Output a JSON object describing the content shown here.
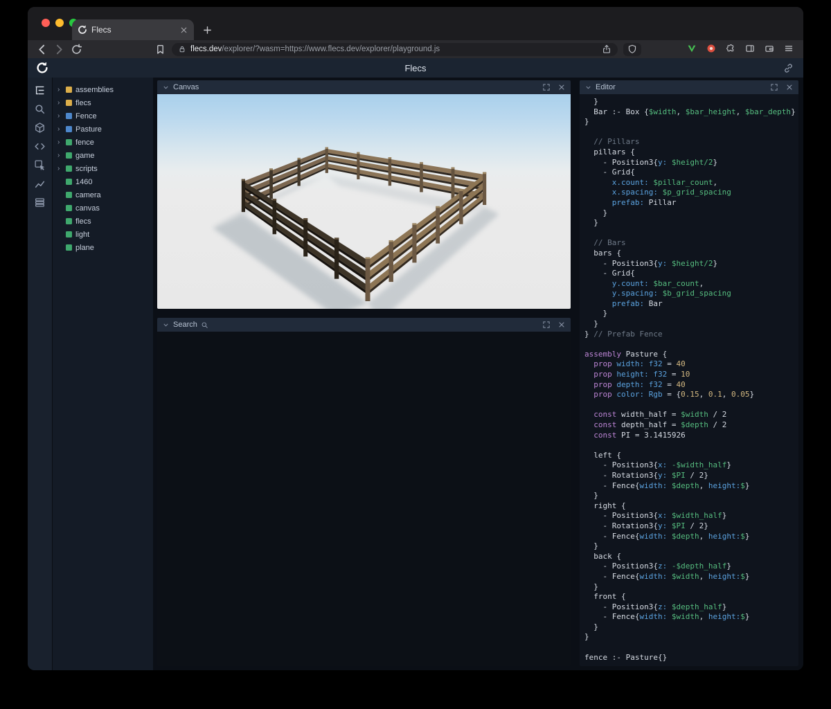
{
  "browser": {
    "tab_title": "Flecs",
    "url": {
      "domain": "flecs.dev",
      "rest": "/explorer/?wasm=https://www.flecs.dev/explorer/playground.js"
    },
    "toolbar_icons": [
      "back-icon",
      "forward-icon",
      "reload-icon",
      "bookmark-icon",
      "lock-icon",
      "share-icon",
      "brave-shield-icon",
      "vimium-extension-icon",
      "red-extension-icon",
      "extensions-puzzle-icon",
      "sidebar-panel-icon",
      "wallet-icon",
      "menu-icon"
    ]
  },
  "app": {
    "title": "Flecs",
    "logo_icon": "flecs-logo-icon",
    "header_link_icon": "link-icon"
  },
  "sidebar": {
    "icons": [
      {
        "name": "entity-tree-icon",
        "icon": "tree",
        "active": true
      },
      {
        "name": "search-icon",
        "icon": "searchI",
        "active": false
      },
      {
        "name": "scene-cube-icon",
        "icon": "cube",
        "active": false
      },
      {
        "name": "script-code-icon",
        "icon": "code",
        "active": false
      },
      {
        "name": "inspect-cursor-icon",
        "icon": "inspect",
        "active": false
      },
      {
        "name": "stats-chart-icon",
        "icon": "chart",
        "active": false
      },
      {
        "name": "memory-rows-icon",
        "icon": "memory",
        "active": false
      }
    ]
  },
  "tree": {
    "items": [
      {
        "label": "assemblies",
        "color": "#dcae4a",
        "expandable": true
      },
      {
        "label": "flecs",
        "color": "#dcae4a",
        "expandable": true
      },
      {
        "label": "Fence",
        "color": "#4d87cb",
        "expandable": true
      },
      {
        "label": "Pasture",
        "color": "#4d87cb",
        "expandable": true
      },
      {
        "label": "fence",
        "color": "#3fa86d",
        "expandable": true
      },
      {
        "label": "game",
        "color": "#3fa86d",
        "expandable": true
      },
      {
        "label": "scripts",
        "color": "#3fa86d",
        "expandable": true
      },
      {
        "label": "1460",
        "color": "#3fa86d",
        "expandable": false
      },
      {
        "label": "camera",
        "color": "#3fa86d",
        "expandable": false
      },
      {
        "label": "canvas",
        "color": "#3fa86d",
        "expandable": false
      },
      {
        "label": "flecs",
        "color": "#3fa86d",
        "expandable": false
      },
      {
        "label": "light",
        "color": "#3fa86d",
        "expandable": false
      },
      {
        "label": "plane",
        "color": "#3fa86d",
        "expandable": false
      }
    ]
  },
  "panels": {
    "canvas": {
      "title": "Canvas"
    },
    "search": {
      "title": "Search"
    },
    "editor": {
      "title": "Editor"
    }
  },
  "scene": {
    "description": "3D render of a square wooden fence enclosure (Pasture assembly) on light gray ground under a pale blue sky",
    "sky_color": "#a9d0ec",
    "ground_color": "#e8e8e8",
    "fence_wood_light": "#8d7554",
    "fence_wood_dark": "#2c251d",
    "shadow_color": "#9aa6ae"
  },
  "editor_code": {
    "lines": [
      [
        [
          "d",
          "  }"
        ]
      ],
      [
        [
          "d",
          "  Bar :- Box {"
        ],
        [
          "v",
          "$width"
        ],
        [
          "d",
          ", "
        ],
        [
          "v",
          "$bar_height"
        ],
        [
          "d",
          ", "
        ],
        [
          "v",
          "$bar_depth"
        ],
        [
          "d",
          "}"
        ]
      ],
      [
        [
          "d",
          "}"
        ]
      ],
      [],
      [
        [
          "c",
          "  // Pillars"
        ]
      ],
      [
        [
          "d",
          "  pillars {"
        ]
      ],
      [
        [
          "d",
          "    - Position3{"
        ],
        [
          "p",
          "y:"
        ],
        [
          "d",
          " "
        ],
        [
          "v",
          "$height/2"
        ],
        [
          "d",
          "}"
        ]
      ],
      [
        [
          "d",
          "    - Grid{"
        ]
      ],
      [
        [
          "p",
          "      x.count:"
        ],
        [
          "d",
          " "
        ],
        [
          "v",
          "$pillar_count"
        ],
        [
          "d",
          ","
        ]
      ],
      [
        [
          "p",
          "      x.spacing:"
        ],
        [
          "d",
          " "
        ],
        [
          "v",
          "$p_grid_spacing"
        ]
      ],
      [
        [
          "p",
          "      prefab:"
        ],
        [
          "d",
          " Pillar"
        ]
      ],
      [
        [
          "d",
          "    }"
        ]
      ],
      [
        [
          "d",
          "  }"
        ]
      ],
      [],
      [
        [
          "c",
          "  // Bars"
        ]
      ],
      [
        [
          "d",
          "  bars {"
        ]
      ],
      [
        [
          "d",
          "    - Position3{"
        ],
        [
          "p",
          "y:"
        ],
        [
          "d",
          " "
        ],
        [
          "v",
          "$height/2"
        ],
        [
          "d",
          "}"
        ]
      ],
      [
        [
          "d",
          "    - Grid{"
        ]
      ],
      [
        [
          "p",
          "      y.count:"
        ],
        [
          "d",
          " "
        ],
        [
          "v",
          "$bar_count"
        ],
        [
          "d",
          ","
        ]
      ],
      [
        [
          "p",
          "      y.spacing:"
        ],
        [
          "d",
          " "
        ],
        [
          "v",
          "$b_grid_spacing"
        ]
      ],
      [
        [
          "p",
          "      prefab:"
        ],
        [
          "d",
          " Bar"
        ]
      ],
      [
        [
          "d",
          "    }"
        ]
      ],
      [
        [
          "d",
          "  }"
        ]
      ],
      [
        [
          "d",
          "} "
        ],
        [
          "c",
          "// Prefab Fence"
        ]
      ],
      [],
      [
        [
          "k",
          "assembly"
        ],
        [
          "d",
          " Pasture {"
        ]
      ],
      [
        [
          "d",
          "  "
        ],
        [
          "k",
          "prop"
        ],
        [
          "d",
          " "
        ],
        [
          "p",
          "width:"
        ],
        [
          "d",
          " "
        ],
        [
          "t",
          "f32"
        ],
        [
          "d",
          " = "
        ],
        [
          "n",
          "40"
        ]
      ],
      [
        [
          "d",
          "  "
        ],
        [
          "k",
          "prop"
        ],
        [
          "d",
          " "
        ],
        [
          "p",
          "height:"
        ],
        [
          "d",
          " "
        ],
        [
          "t",
          "f32"
        ],
        [
          "d",
          " = "
        ],
        [
          "n",
          "10"
        ]
      ],
      [
        [
          "d",
          "  "
        ],
        [
          "k",
          "prop"
        ],
        [
          "d",
          " "
        ],
        [
          "p",
          "depth:"
        ],
        [
          "d",
          " "
        ],
        [
          "t",
          "f32"
        ],
        [
          "d",
          " = "
        ],
        [
          "n",
          "40"
        ]
      ],
      [
        [
          "d",
          "  "
        ],
        [
          "k",
          "prop"
        ],
        [
          "d",
          " "
        ],
        [
          "p",
          "color:"
        ],
        [
          "d",
          " "
        ],
        [
          "t",
          "Rgb"
        ],
        [
          "d",
          " = {"
        ],
        [
          "n",
          "0.15"
        ],
        [
          "d",
          ", "
        ],
        [
          "n",
          "0.1"
        ],
        [
          "d",
          ", "
        ],
        [
          "n",
          "0.05"
        ],
        [
          "d",
          "}"
        ]
      ],
      [],
      [
        [
          "d",
          "  "
        ],
        [
          "k",
          "const"
        ],
        [
          "d",
          " width_half = "
        ],
        [
          "v",
          "$width"
        ],
        [
          "d",
          " / 2"
        ]
      ],
      [
        [
          "d",
          "  "
        ],
        [
          "k",
          "const"
        ],
        [
          "d",
          " depth_half = "
        ],
        [
          "v",
          "$depth"
        ],
        [
          "d",
          " / 2"
        ]
      ],
      [
        [
          "d",
          "  "
        ],
        [
          "k",
          "const"
        ],
        [
          "d",
          " PI = 3.1415926"
        ]
      ],
      [],
      [
        [
          "d",
          "  left {"
        ]
      ],
      [
        [
          "d",
          "    - Position3{"
        ],
        [
          "p",
          "x:"
        ],
        [
          "d",
          " "
        ],
        [
          "v",
          "-$width_half"
        ],
        [
          "d",
          "}"
        ]
      ],
      [
        [
          "d",
          "    - Rotation3{"
        ],
        [
          "p",
          "y:"
        ],
        [
          "d",
          " "
        ],
        [
          "v",
          "$PI"
        ],
        [
          "d",
          " / 2}"
        ]
      ],
      [
        [
          "d",
          "    - Fence{"
        ],
        [
          "p",
          "width:"
        ],
        [
          "d",
          " "
        ],
        [
          "v",
          "$depth"
        ],
        [
          "d",
          ", "
        ],
        [
          "p",
          "height:"
        ],
        [
          "v",
          "$"
        ],
        [
          "d",
          "}"
        ]
      ],
      [
        [
          "d",
          "  }"
        ]
      ],
      [
        [
          "d",
          "  right {"
        ]
      ],
      [
        [
          "d",
          "    - Position3{"
        ],
        [
          "p",
          "x:"
        ],
        [
          "d",
          " "
        ],
        [
          "v",
          "$width_half"
        ],
        [
          "d",
          "}"
        ]
      ],
      [
        [
          "d",
          "    - Rotation3{"
        ],
        [
          "p",
          "y:"
        ],
        [
          "d",
          " "
        ],
        [
          "v",
          "$PI"
        ],
        [
          "d",
          " / 2}"
        ]
      ],
      [
        [
          "d",
          "    - Fence{"
        ],
        [
          "p",
          "width:"
        ],
        [
          "d",
          " "
        ],
        [
          "v",
          "$depth"
        ],
        [
          "d",
          ", "
        ],
        [
          "p",
          "height:"
        ],
        [
          "v",
          "$"
        ],
        [
          "d",
          "}"
        ]
      ],
      [
        [
          "d",
          "  }"
        ]
      ],
      [
        [
          "d",
          "  back {"
        ]
      ],
      [
        [
          "d",
          "    - Position3{"
        ],
        [
          "p",
          "z:"
        ],
        [
          "d",
          " "
        ],
        [
          "v",
          "-$depth_half"
        ],
        [
          "d",
          "}"
        ]
      ],
      [
        [
          "d",
          "    - Fence{"
        ],
        [
          "p",
          "width:"
        ],
        [
          "d",
          " "
        ],
        [
          "v",
          "$width"
        ],
        [
          "d",
          ", "
        ],
        [
          "p",
          "height:"
        ],
        [
          "v",
          "$"
        ],
        [
          "d",
          "}"
        ]
      ],
      [
        [
          "d",
          "  }"
        ]
      ],
      [
        [
          "d",
          "  front {"
        ]
      ],
      [
        [
          "d",
          "    - Position3{"
        ],
        [
          "p",
          "z:"
        ],
        [
          "d",
          " "
        ],
        [
          "v",
          "$depth_half"
        ],
        [
          "d",
          "}"
        ]
      ],
      [
        [
          "d",
          "    - Fence{"
        ],
        [
          "p",
          "width:"
        ],
        [
          "d",
          " "
        ],
        [
          "v",
          "$width"
        ],
        [
          "d",
          ", "
        ],
        [
          "p",
          "height:"
        ],
        [
          "v",
          "$"
        ],
        [
          "d",
          "}"
        ]
      ],
      [
        [
          "d",
          "  }"
        ]
      ],
      [
        [
          "d",
          "}"
        ]
      ],
      [],
      [
        [
          "d",
          "fence :- Pasture{}"
        ]
      ]
    ]
  }
}
